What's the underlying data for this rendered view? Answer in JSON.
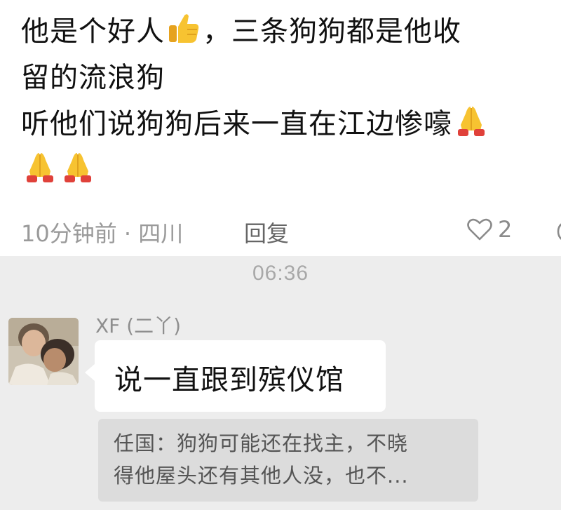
{
  "comment": {
    "lines": [
      [
        "他是个好人",
        "，三条狗狗都是他收"
      ],
      [
        "留的流浪狗"
      ],
      [
        "听他们说狗狗后来一直在江边惨嚎"
      ],
      [
        ""
      ]
    ],
    "emoji": [
      "thumbs-up",
      "folded-hands",
      "folded-hands",
      "folded-hands"
    ],
    "time": "10分钟前 · 四川",
    "reply_label": "回复",
    "like_count": "2"
  },
  "chat": {
    "timestamp": "06:36",
    "sender_name": "XF (二丫)",
    "message": "说一直跟到殡仪馆",
    "quote_lines": [
      "任国：狗狗可能还在找主，不晓",
      "得他屋头还有其他人没，也不..."
    ]
  },
  "colors": {
    "emoji_yellow": "#f7c331",
    "emoji_cuff": "#e0413a",
    "chat_background": "#ededed",
    "quote_background": "#dcdcdc"
  }
}
